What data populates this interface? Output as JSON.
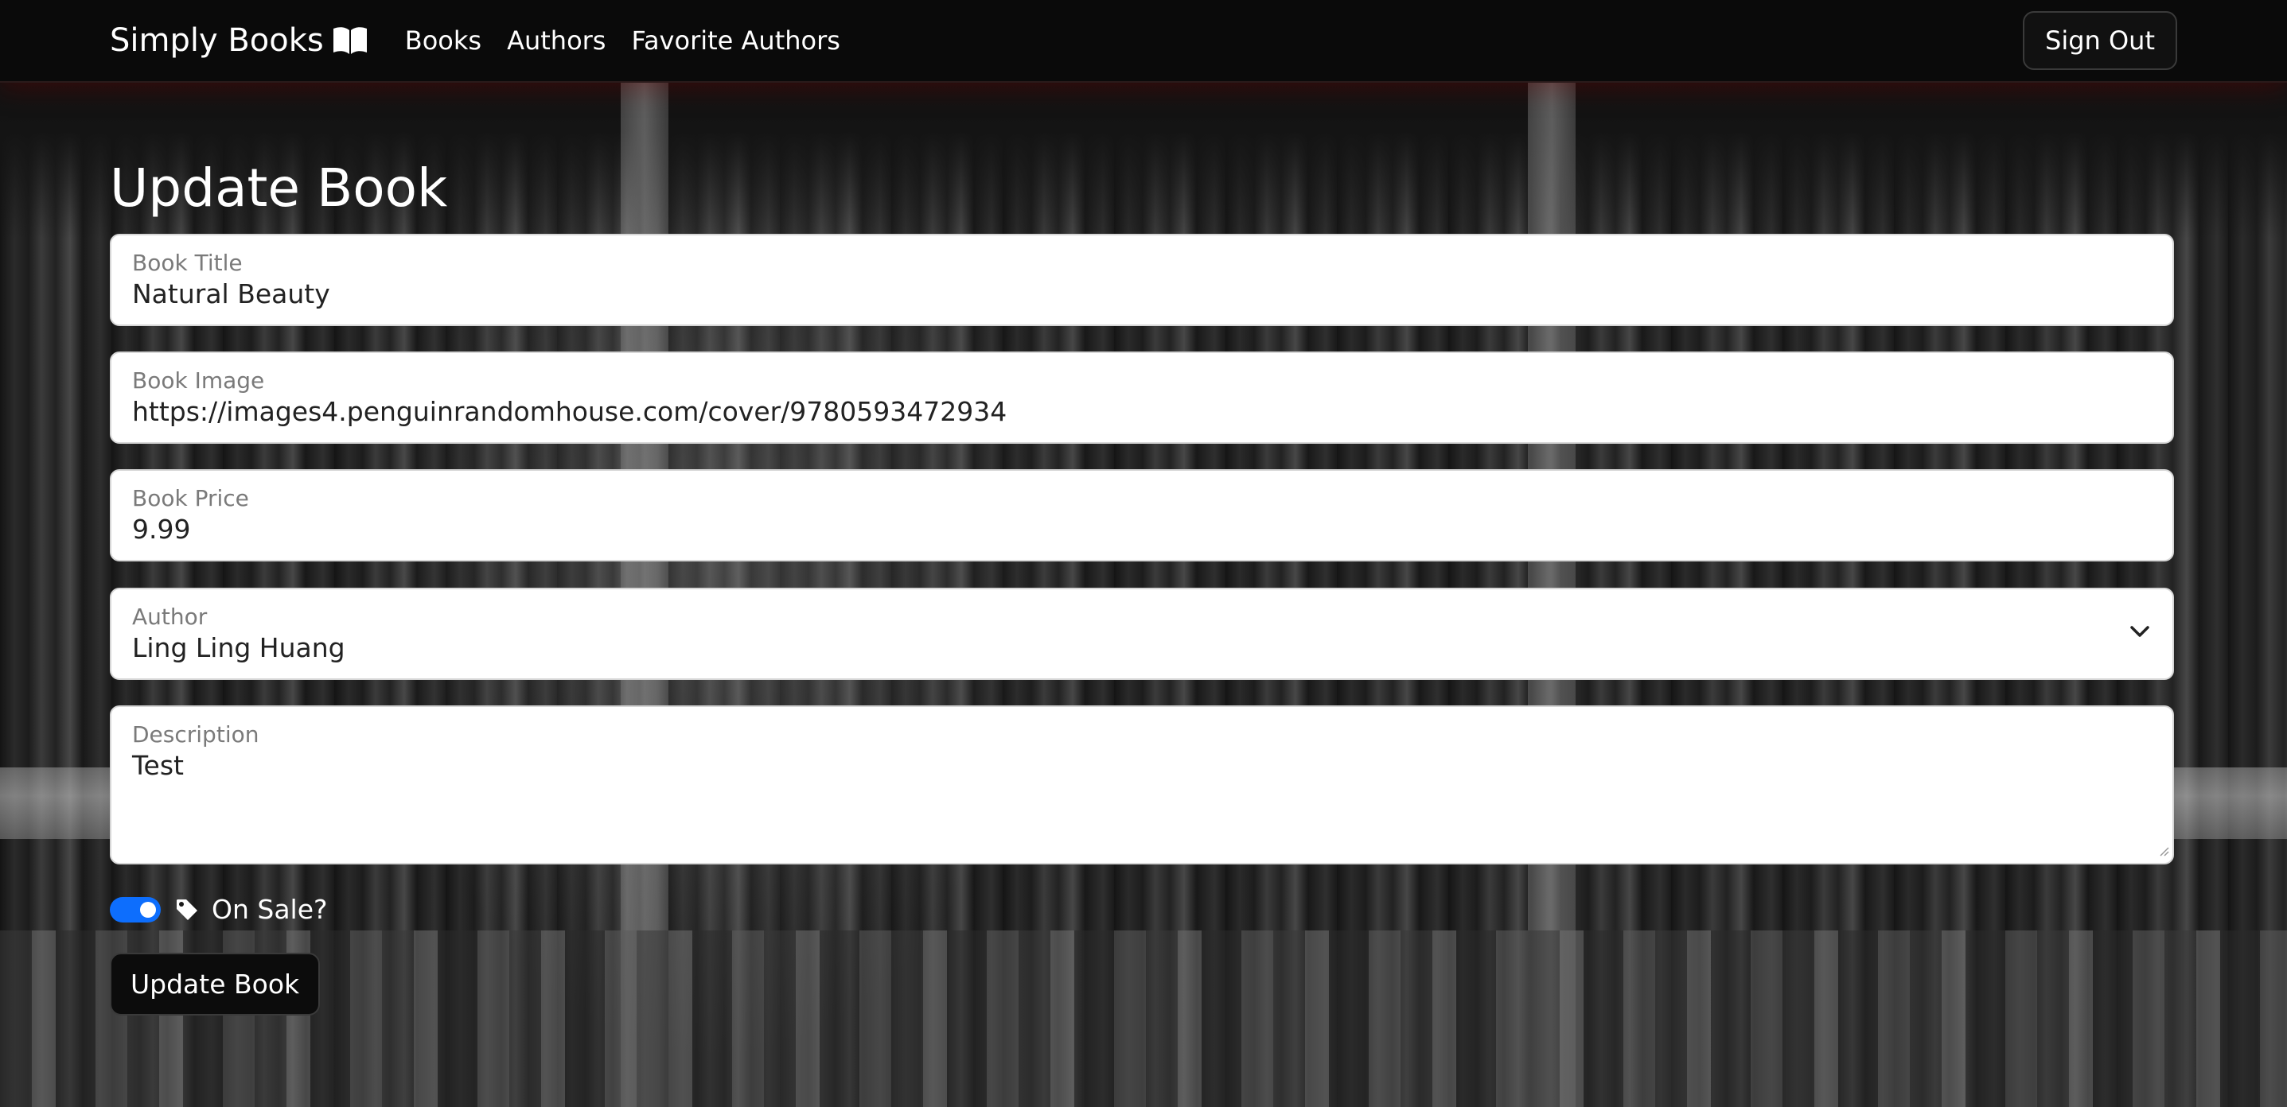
{
  "navbar": {
    "brand": "Simply Books",
    "links": [
      "Books",
      "Authors",
      "Favorite Authors"
    ],
    "sign_out": "Sign Out"
  },
  "page_title": "Update Book",
  "form": {
    "title": {
      "label": "Book Title",
      "value": "Natural Beauty"
    },
    "image": {
      "label": "Book Image",
      "value": "https://images4.penguinrandomhouse.com/cover/9780593472934"
    },
    "price": {
      "label": "Book Price",
      "value": "9.99"
    },
    "author": {
      "label": "Author",
      "value": "Ling Ling Huang"
    },
    "description": {
      "label": "Description",
      "value": "Test"
    },
    "sale": {
      "label": "On Sale?",
      "checked": true
    },
    "submit": "Update Book"
  },
  "colors": {
    "toggle_on": "#0d6efd",
    "navbar_bg": "#0a0a0a"
  },
  "icons": [
    "book-icon",
    "chevron-down-icon",
    "tag-icon"
  ]
}
